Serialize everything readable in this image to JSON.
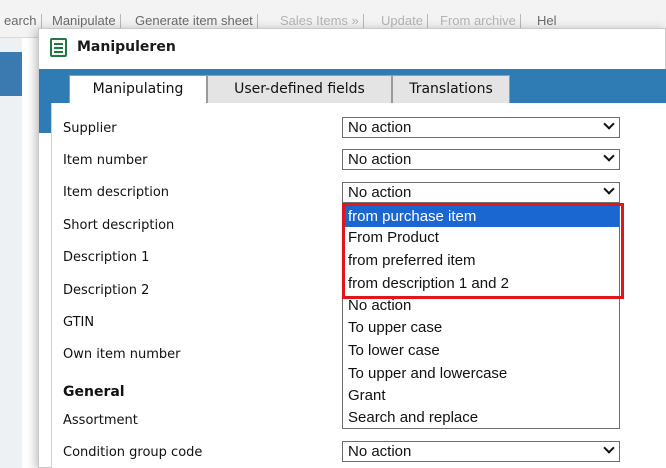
{
  "background_menu": {
    "items": [
      {
        "label": "earch",
        "dim": false
      },
      {
        "label": "Manipulate",
        "dim": false
      },
      {
        "label": "Generate item sheet",
        "dim": false
      },
      {
        "label": "Sales Items »",
        "dim": true
      },
      {
        "label": "Update",
        "dim": true
      },
      {
        "label": "From archive",
        "dim": true
      },
      {
        "label": "Hel",
        "dim": false
      }
    ]
  },
  "dialog": {
    "title": "Manipuleren",
    "icon": "document-list-icon",
    "tabs": [
      {
        "label": "Manipulating",
        "active": true
      },
      {
        "label": "User-defined fields",
        "active": false
      },
      {
        "label": "Translations",
        "active": false
      }
    ],
    "rows": [
      {
        "label": "Supplier",
        "value": "No action"
      },
      {
        "label": "Item number",
        "value": "No action"
      },
      {
        "label": "Item description",
        "value": "No action"
      },
      {
        "label": "Short description"
      },
      {
        "label": "Description 1"
      },
      {
        "label": "Description 2"
      },
      {
        "label": "GTIN"
      },
      {
        "label": "Own item number"
      },
      {
        "label": "General",
        "section": true
      },
      {
        "label": "Assortment"
      },
      {
        "label": "Condition group code",
        "value": "No action"
      }
    ],
    "dropdown": {
      "highlighted_options": [
        "from purchase item",
        "From Product",
        "from preferred item",
        "from description 1 and 2"
      ],
      "other_options": [
        "No action",
        "To upper case",
        "To lower case",
        "To upper and lowercase",
        "Grant",
        "Search and replace"
      ],
      "selected": "from purchase item"
    }
  },
  "colors": {
    "tab_bar": "#2f7cb5",
    "selected_option": "#1a67d2",
    "highlight_border": "#e0161b"
  }
}
